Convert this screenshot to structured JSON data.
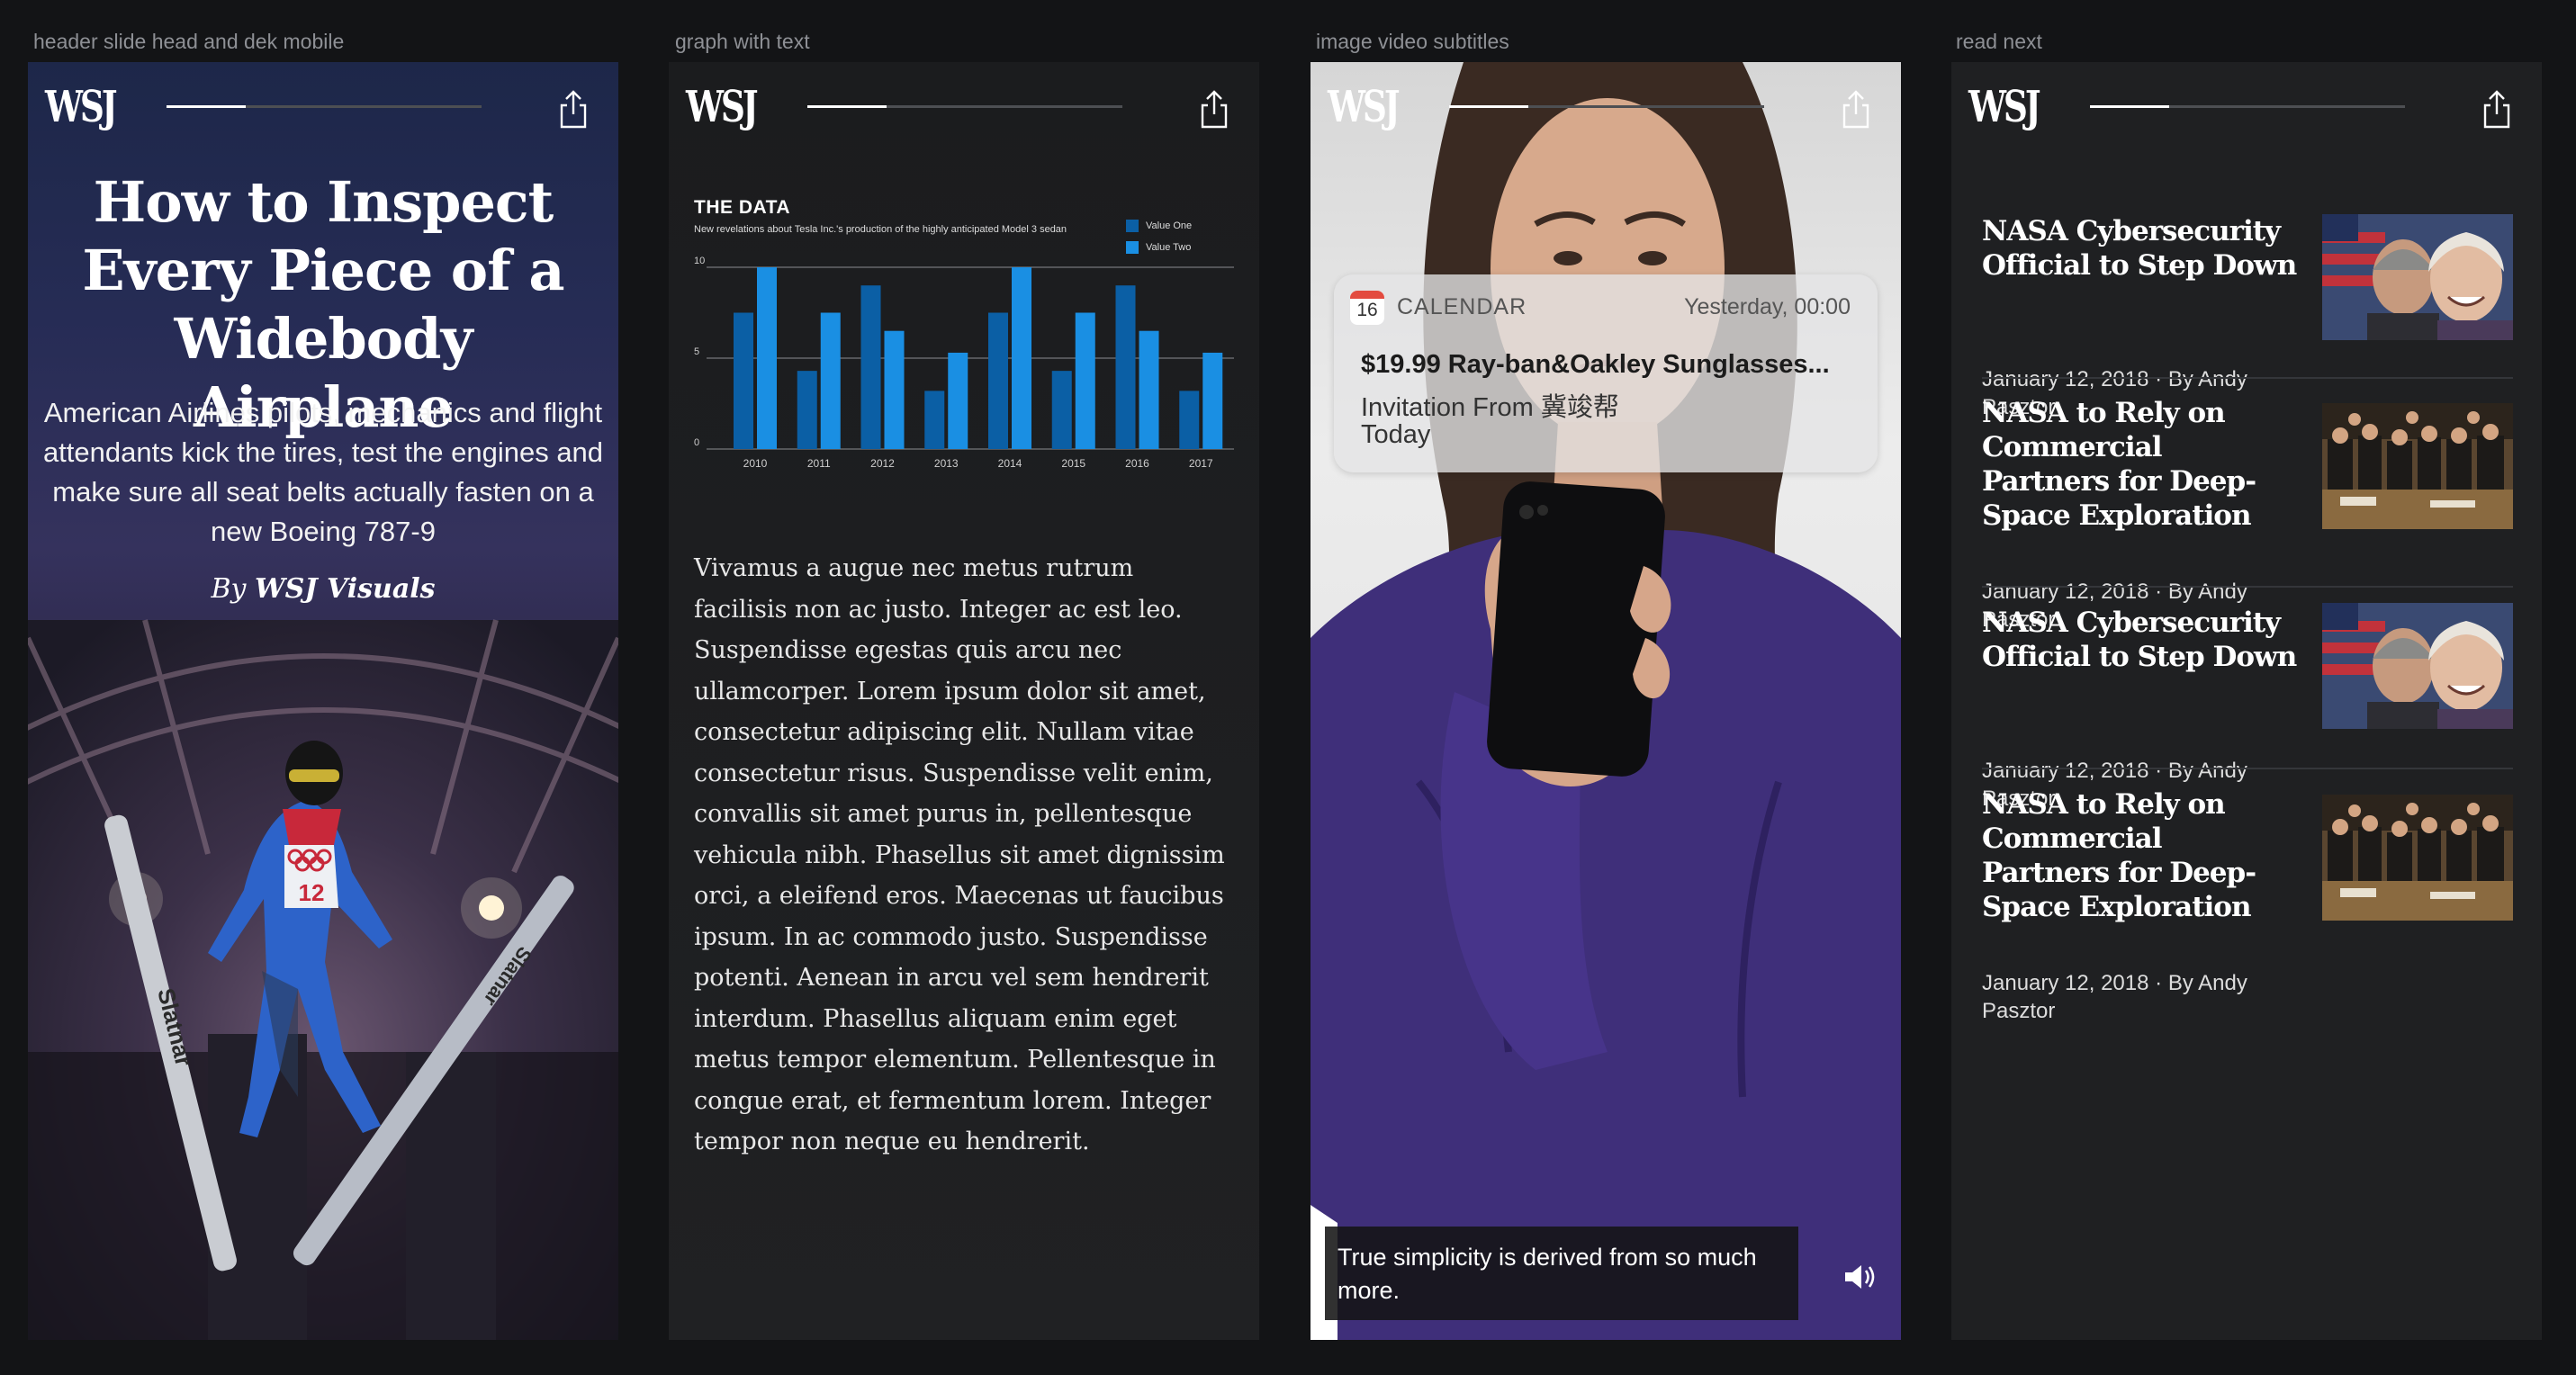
{
  "frames": [
    {
      "label": "header slide head and dek mobile"
    },
    {
      "label": "graph with text"
    },
    {
      "label": "image video subtitles"
    },
    {
      "label": "read next"
    }
  ],
  "topbar": {
    "logo": "WSJ",
    "share_icon": "share-icon",
    "progress": 0.25
  },
  "header_slide": {
    "headline": "How to Inspect Every Piece of a Widebody Airplane",
    "dek": "American Airlines pilots, mechanics and flight attendants kick the tires, test the engines and make sure all seat belts actually fasten on a new Boeing 787-9",
    "byline_prefix": "By",
    "byline_author": "WSJ Visuals",
    "photo_bib_number": "12",
    "photo_ski_text_left": "Slatnar",
    "photo_ski_text_right": "Slatnar"
  },
  "graph_slide": {
    "body": "Vivamus a augue nec metus rutrum facilisis non ac justo. Integer ac est leo. Suspendisse egestas quis arcu nec ullamcorper. Lorem ipsum dolor sit amet, consectetur adipiscing elit. Nullam vitae consectetur risus. Suspendisse velit enim, convallis sit amet purus in, pellentesque vehicula nibh. Phasellus sit amet dignissim orci, a eleifend eros. Maecenas ut faucibus ipsum. In ac commodo justo. Suspendisse potenti. Aenean in arcu vel sem hendrerit interdum. Phasellus aliquam enim eget metus tempor elementum. Pellentesque in congue erat, et fermentum lorem. Integer tempor non neque eu hendrerit."
  },
  "chart_data": {
    "type": "bar",
    "title": "THE DATA",
    "subtitle": "New revelations about Tesla Inc.'s production of the highly anticipated Model 3 sedan",
    "categories": [
      "2010",
      "2011",
      "2012",
      "2013",
      "2014",
      "2015",
      "2016",
      "2017"
    ],
    "series": [
      {
        "name": "Value One",
        "color": "#0b5fa5",
        "values": [
          7.5,
          4.3,
          9,
          3.2,
          7.5,
          4.3,
          9,
          3.2
        ]
      },
      {
        "name": "Value Two",
        "color": "#1a8fe3",
        "values": [
          10,
          7.5,
          6.5,
          5.3,
          10,
          7.5,
          6.5,
          5.3
        ]
      }
    ],
    "yticks": [
      "0",
      "5",
      "10"
    ],
    "ylim": [
      0,
      10
    ],
    "grid": true,
    "legend": "top-right"
  },
  "video_slide": {
    "notification": {
      "app_icon_day": "16",
      "app": "CALENDAR",
      "time": "Yesterday, 00:00",
      "title": "$19.99 Ray-ban&Oakley Sunglasses...",
      "line1": "Invitation From 冀竣帮",
      "line2": "Today"
    },
    "subtitle": "True simplicity is derived from so much more.",
    "speaker_icon": "speaker-icon"
  },
  "read_next": {
    "articles": [
      {
        "title": "NASA Cybersecurity Official to Step Down",
        "date": "January 12, 2018",
        "byline": "By Andy Pasztor",
        "thumb": "portrait-flag"
      },
      {
        "title": "NASA to Rely on Commercial Partners for Deep-Space Exploration",
        "date": "January 12, 2018",
        "byline": "By Andy Pasztor",
        "thumb": "group-photo"
      },
      {
        "title": "NASA Cybersecurity Official to Step Down",
        "date": "January 12, 2018",
        "byline": "By Andy Pasztor",
        "thumb": "portrait-flag"
      },
      {
        "title": "NASA to Rely on Commercial Partners for Deep-Space Exploration",
        "date": "January 12, 2018",
        "byline": "By Andy Pasztor",
        "thumb": "group-photo"
      }
    ]
  }
}
